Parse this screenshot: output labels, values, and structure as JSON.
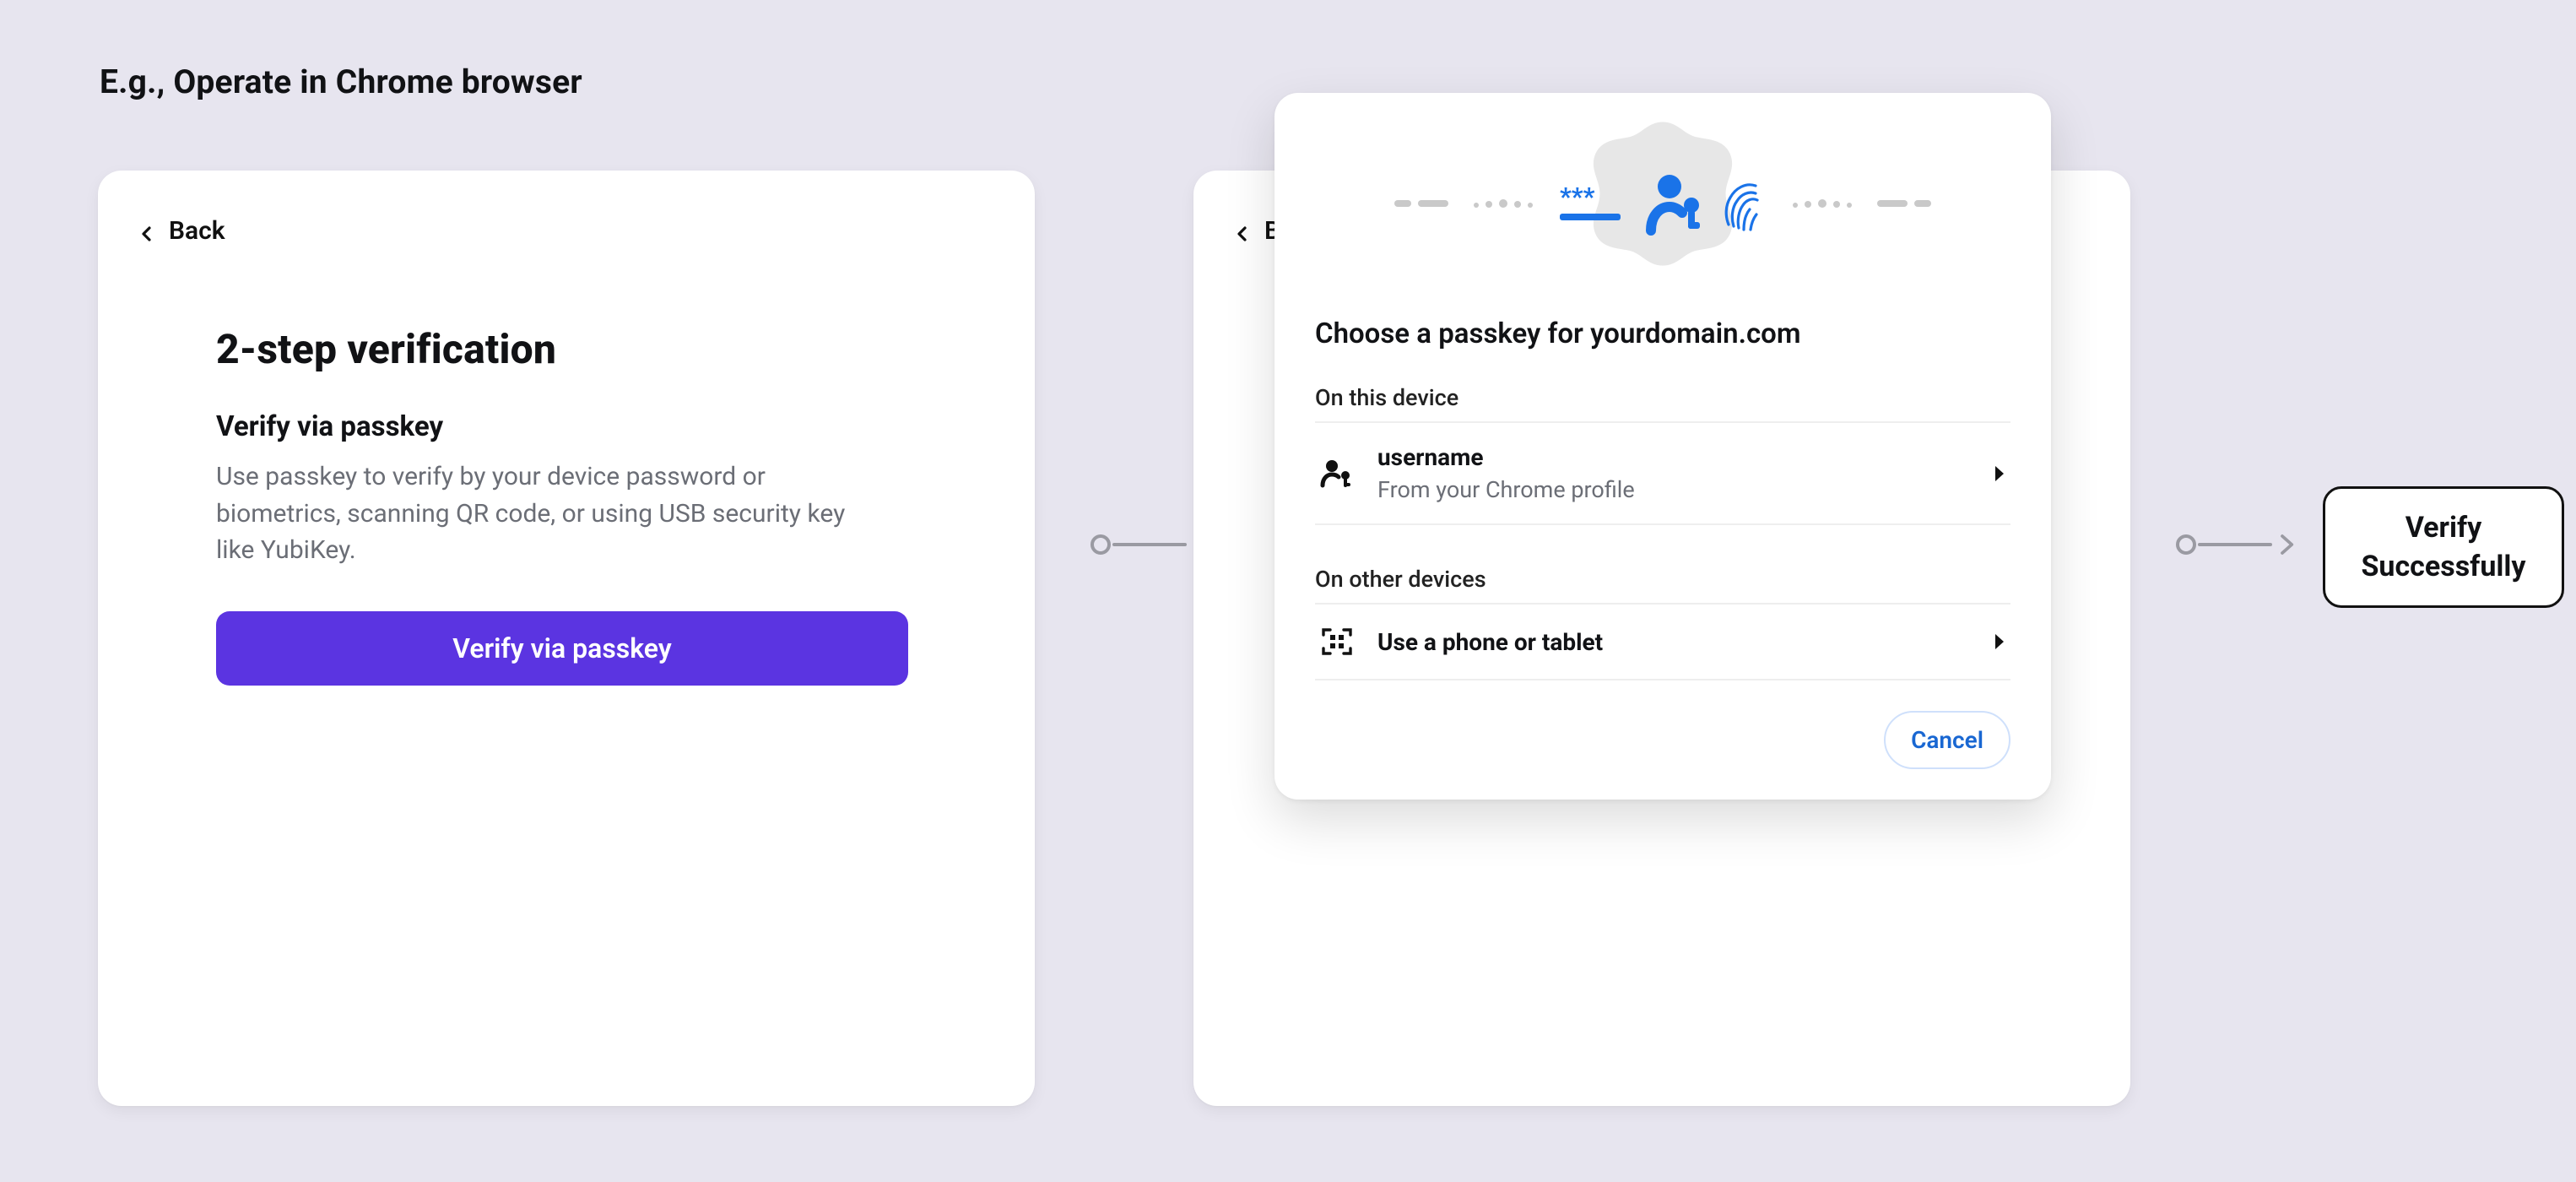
{
  "caption": "E.g., Operate in Chrome browser",
  "card1": {
    "back_label": "Back",
    "title": "2-step verification",
    "subtitle": "Verify via passkey",
    "description": "Use passkey to verify by your device password or biometrics, scanning QR code, or using USB security key like YubiKey.",
    "button_label": "Verify via passkey"
  },
  "card2": {
    "back_label": "Back"
  },
  "dialog": {
    "title_prefix": "Choose a passkey for ",
    "domain": "yourdomain.com",
    "section_this_device": "On this device",
    "row_device": {
      "username": "username",
      "source": "From your Chrome profile"
    },
    "section_other": "On other devices",
    "row_other": {
      "label": "Use a phone or tablet"
    },
    "cancel_label": "Cancel"
  },
  "result": {
    "line1": "Verify",
    "line2": "Successfully"
  }
}
